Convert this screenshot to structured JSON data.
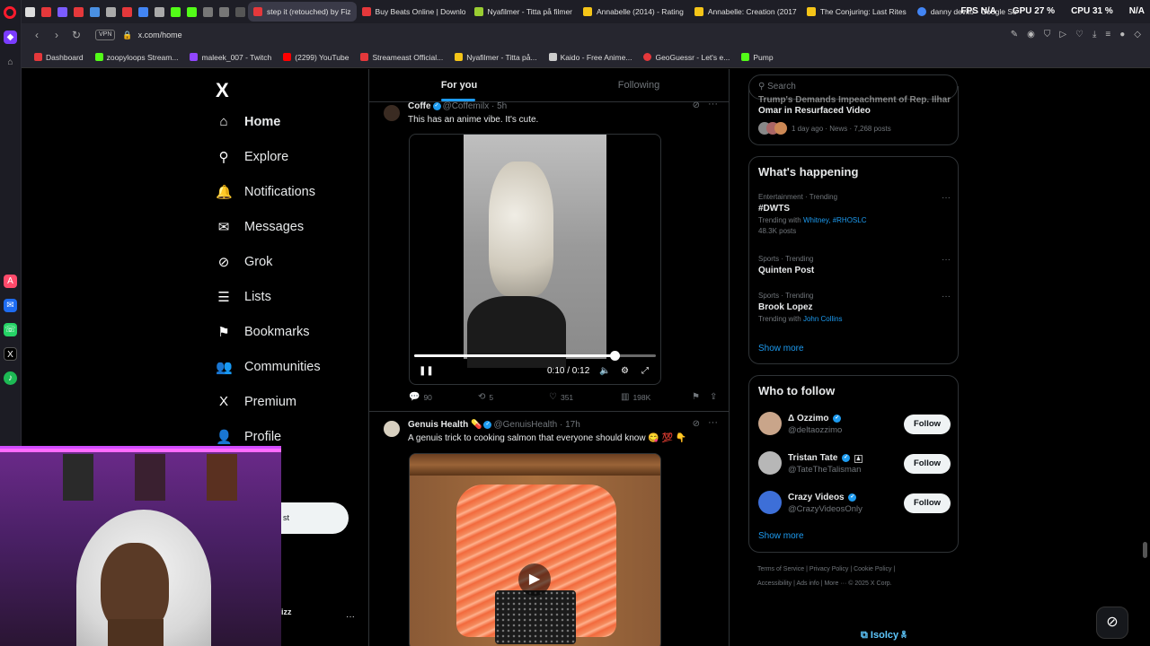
{
  "browser": {
    "tabs": [
      {
        "label": "step it (retouched) by Fiz",
        "color": "#e5383b"
      },
      {
        "label": "Buy Beats Online | Downlo",
        "color": "#e5383b"
      },
      {
        "label": "Nyafilmer - Titta på filmer",
        "color": "#9acd32"
      },
      {
        "label": "Annabelle (2014) - Rating",
        "color": "#f5c518"
      },
      {
        "label": "Annabelle: Creation (2017",
        "color": "#f5c518"
      },
      {
        "label": "The Conjuring: Last Rites",
        "color": "#f5c518"
      },
      {
        "label": "danny devito - Google Se",
        "color": "#4285f4"
      }
    ],
    "perf": {
      "fps": "FPS N/A",
      "gpu": "GPU 27 %",
      "cpu": "CPU 31 %",
      "extra": "N/A"
    },
    "vpn_label": "VPN",
    "url": "x.com/home",
    "bookmarks": [
      {
        "label": "Dashboard",
        "color": "#e5383b"
      },
      {
        "label": "zoopyloops Stream...",
        "color": "#53fc18"
      },
      {
        "label": "maleek_007 - Twitch",
        "color": "#9146ff"
      },
      {
        "label": "(2299) YouTube",
        "color": "#ff0000"
      },
      {
        "label": "Streameast Official...",
        "color": "#e5383b"
      },
      {
        "label": "Nyafilmer - Titta på...",
        "color": "#f5c518"
      },
      {
        "label": "Kaido - Free Anime...",
        "color": "#cccccc"
      },
      {
        "label": "GeoGuessr - Let's e...",
        "color": "#e5383b"
      },
      {
        "label": "Pump",
        "color": "#53fc18"
      }
    ]
  },
  "nav": {
    "logo": "X",
    "items": [
      {
        "label": "Home",
        "icon": "⌂"
      },
      {
        "label": "Explore",
        "icon": "⚲"
      },
      {
        "label": "Notifications",
        "icon": "🔔"
      },
      {
        "label": "Messages",
        "icon": "✉"
      },
      {
        "label": "Grok",
        "icon": "⊘"
      },
      {
        "label": "Lists",
        "icon": "☰"
      },
      {
        "label": "Bookmarks",
        "icon": "⚑"
      },
      {
        "label": "Communities",
        "icon": "👥"
      },
      {
        "label": "Premium",
        "icon": "X"
      },
      {
        "label": "Profile",
        "icon": "👤"
      }
    ],
    "post_button_partial": "st",
    "account_partial": "izz",
    "account_more": "···"
  },
  "feed": {
    "tabs": [
      "For you",
      "Following"
    ],
    "post1": {
      "name": "Coffe",
      "handle": "@Coffemilx · 5h",
      "text": "This has an anime vibe. It's cute.",
      "video_time": "0:10 / 0:12",
      "video_progress": 0.83,
      "replies": "90",
      "reposts": "5",
      "likes": "351",
      "views": "198K"
    },
    "post2": {
      "name": "Genuis Health 💊",
      "handle": "@GenuisHealth · 17h",
      "text": "A genuis trick to cooking salmon that everyone should know 😋 💯 👇"
    }
  },
  "sidebar": {
    "search_placeholder": "Search",
    "news_partial": {
      "title_top": "Trump's Demands Impeachment of Rep. Ilhan",
      "title": "Omar in Resurfaced Video",
      "meta": "1 day ago · News · 7,268 posts"
    },
    "happening": {
      "title": "What's happening",
      "trends": [
        {
          "meta": "Entertainment · Trending",
          "name": "#DWTS",
          "with_prefix": "Trending with ",
          "with_links": "Whitney, #RHOSLC",
          "count": "48.3K posts"
        },
        {
          "meta": "Sports · Trending",
          "name": "Quinten Post",
          "with_prefix": "",
          "with_links": "",
          "count": ""
        },
        {
          "meta": "Sports · Trending",
          "name": "Brook Lopez",
          "with_prefix": "Trending with ",
          "with_links": "John Collins",
          "count": ""
        }
      ],
      "show_more": "Show more"
    },
    "who_to_follow": {
      "title": "Who to follow",
      "accounts": [
        {
          "name": "Δ Ozzimo",
          "handle": "@deltaozzimo",
          "color": "#c9a58a"
        },
        {
          "name": "Tristan Tate",
          "handle": "@TateTheTalisman",
          "color": "#b7b7b7"
        },
        {
          "name": "Crazy Videos",
          "handle": "@CrazyVideosOnly",
          "color": "#3d6fd8"
        }
      ],
      "follow_label": "Follow",
      "show_more": "Show more"
    },
    "footer": {
      "line1": "Terms of Service  |  Privacy Policy  |  Cookie Policy  |",
      "line2": "Accessibility  |  Ads info  |  More ···  © 2025 X Corp."
    }
  },
  "overlay": {
    "brand": "Isolcy"
  }
}
